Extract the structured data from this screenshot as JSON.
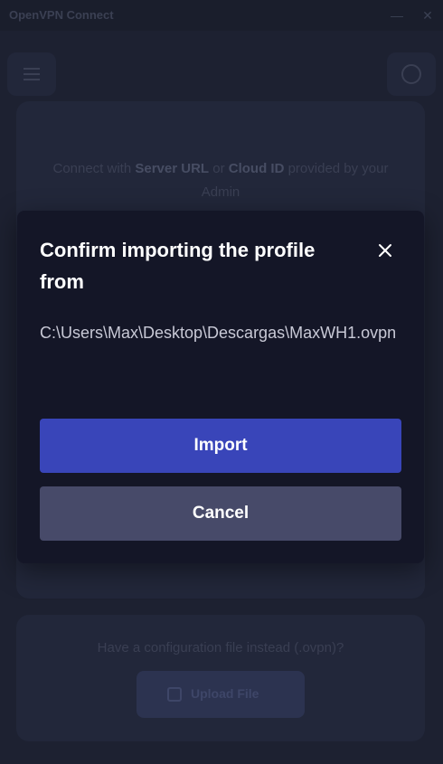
{
  "window": {
    "title": "OpenVPN Connect",
    "minimize_glyph": "—",
    "close_glyph": "✕"
  },
  "background": {
    "description_prefix": "Connect with ",
    "server_url": "Server URL",
    "or": " or ",
    "cloud_id": "Cloud ID",
    "description_suffix": " provided by your Admin",
    "config_question": "Have a configuration file instead (.ovpn)?",
    "upload_label": "Upload File"
  },
  "dialog": {
    "heading": "Confirm importing the profile from",
    "file_path": "C:\\Users\\Max\\Desktop\\Descargas\\MaxWH1.ovpn",
    "import_label": "Import",
    "cancel_label": "Cancel"
  },
  "icons": {
    "menu": "hamburger-icon",
    "help": "help-icon",
    "close": "close-icon",
    "upload": "upload-icon"
  },
  "colors": {
    "modal_bg": "#141627",
    "import_button": "#3945b9",
    "cancel_button": "#474a69",
    "app_bg": "#1d2131"
  }
}
